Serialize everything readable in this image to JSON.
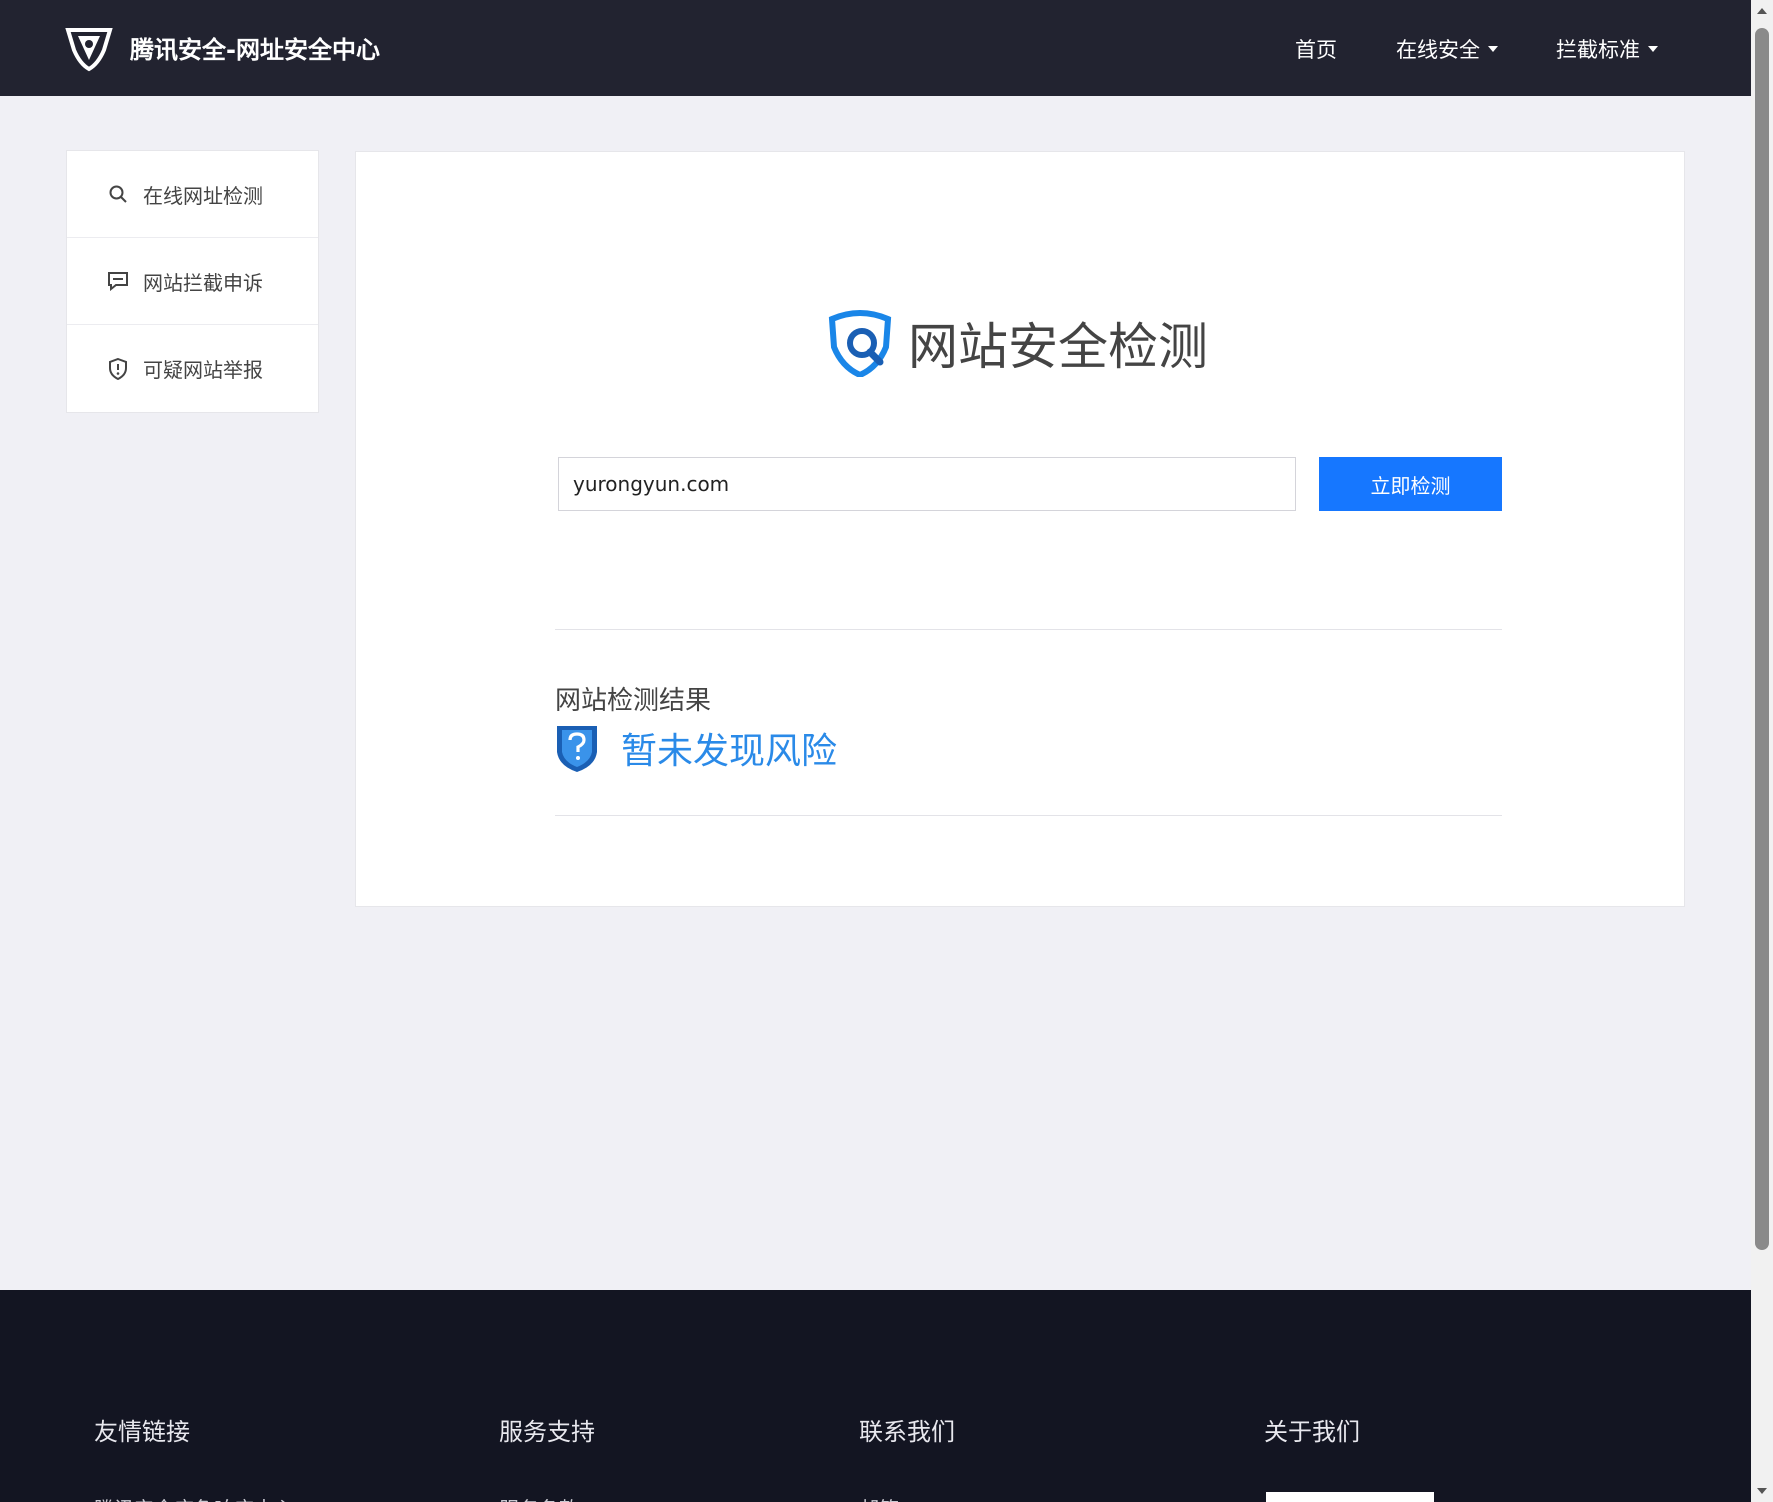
{
  "header": {
    "title": "腾讯安全-网址安全中心",
    "nav": [
      {
        "label": "首页",
        "has_dropdown": false
      },
      {
        "label": "在线安全",
        "has_dropdown": true
      },
      {
        "label": "拦截标准",
        "has_dropdown": true
      }
    ]
  },
  "sidebar": {
    "items": [
      {
        "label": "在线网址检测",
        "icon": "search-icon"
      },
      {
        "label": "网站拦截申诉",
        "icon": "message-icon"
      },
      {
        "label": "可疑网站举报",
        "icon": "shield-alert-icon"
      }
    ]
  },
  "main": {
    "hero_title": "网站安全检测",
    "url_input_value": "yurongyun.com",
    "check_button_label": "立即检测",
    "result_label": "网站检测结果",
    "result_status": "暂未发现风险"
  },
  "footer": {
    "columns": [
      {
        "heading": "友情链接",
        "first_link": "腾讯安全应急响应中心"
      },
      {
        "heading": "服务支持",
        "first_link": "服务条款"
      },
      {
        "heading": "联系我们",
        "first_link": "邮箱"
      },
      {
        "heading": "关于我们",
        "first_link": ""
      }
    ]
  },
  "colors": {
    "header_bg": "#222330",
    "accent_blue": "#1677ff",
    "result_blue": "#2a8ae8",
    "page_bg": "#f0f0f5",
    "footer_bg": "#131522"
  }
}
